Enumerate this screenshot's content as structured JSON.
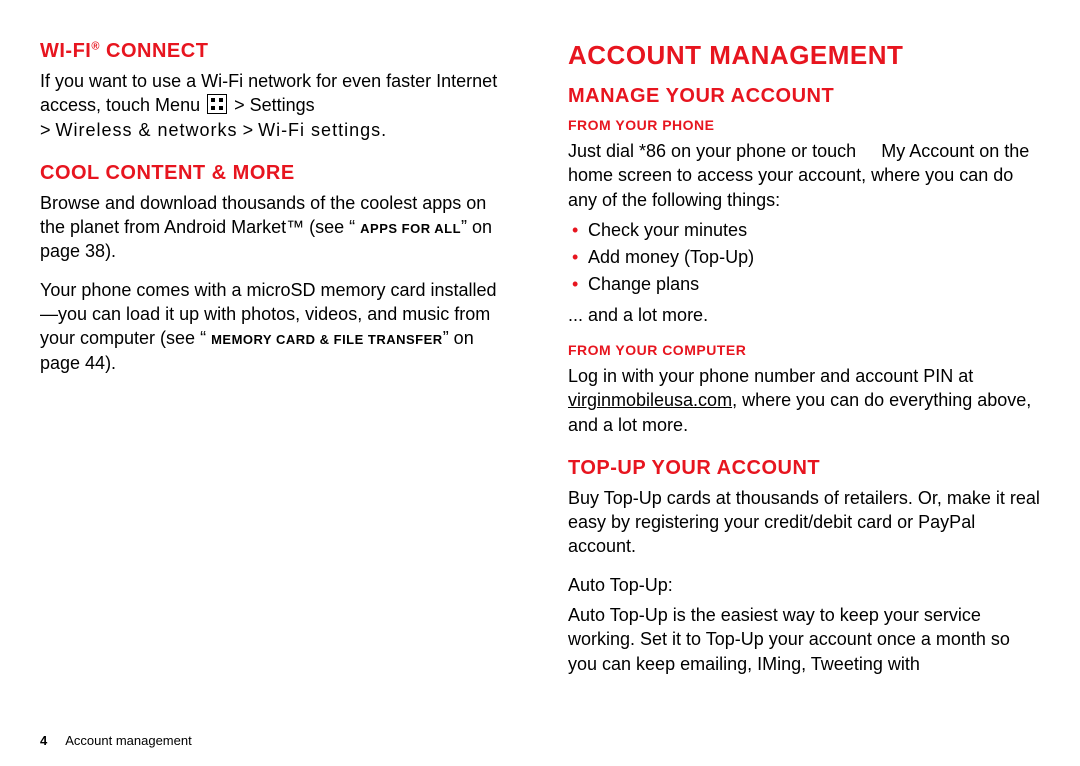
{
  "left": {
    "wifi_heading_pre": "Wi-Fi",
    "wifi_heading_sup": "®",
    "wifi_heading_post": " connect",
    "wifi_p_a": "If you want to use a Wi-Fi network for even faster Internet access, touch Menu ",
    "wifi_p_b": " > Settings",
    "wifi_p_c": "> ",
    "wifi_p_c2": "Wireless & networks",
    "wifi_p_d": " > ",
    "wifi_p_d2": "Wi-Fi settings",
    "wifi_p_e": ".",
    "cool_heading": "Cool content & more",
    "cool_p1_a": "Browse and download thousands of the coolest apps on the planet from Android Market™ (see “ ",
    "cool_p1_smallcaps": "Apps for all",
    "cool_p1_b": "” on page 38).",
    "cool_p2_a": "Your phone comes with a microSD memory card installed—you can load it up with photos, videos, and music from your computer (see “ ",
    "cool_p2_smallcaps": "Memory card & file transfer",
    "cool_p2_b": "” on page 44)."
  },
  "right": {
    "acct_h1": "Account management",
    "manage_h2": "Manage your account",
    "from_phone_h3": "From your phone",
    "from_phone_p_a": "Just dial *86 on your phone or touch ",
    "from_phone_p_b": "My Account",
    "from_phone_p_c": " on the home screen to access your account, where you can do any of the following things:",
    "bullets": {
      "b1": "Check your minutes",
      "b2": "Add money (Top-Up)",
      "b3": "Change plans"
    },
    "and_more": "... and a lot more.",
    "from_computer_h3": "From your computer",
    "from_comp_p_a": "Log in with your phone number and account PIN at ",
    "from_comp_link": "virginmobileusa.com",
    "from_comp_p_b": ", where you can do everything above, and a lot more.",
    "topup_h2": "Top-Up your account",
    "topup_p1": "Buy Top-Up cards at thousands of retailers. Or, make it real easy by registering your credit/debit card or PayPal account.",
    "topup_p2": "Auto Top-Up:",
    "topup_p3": "Auto Top-Up is the easiest way to keep your service working. Set it to Top-Up your account once a month so you can keep emailing, IMing, Tweeting with"
  },
  "footer": {
    "page_number": "4",
    "section": "Account management"
  }
}
